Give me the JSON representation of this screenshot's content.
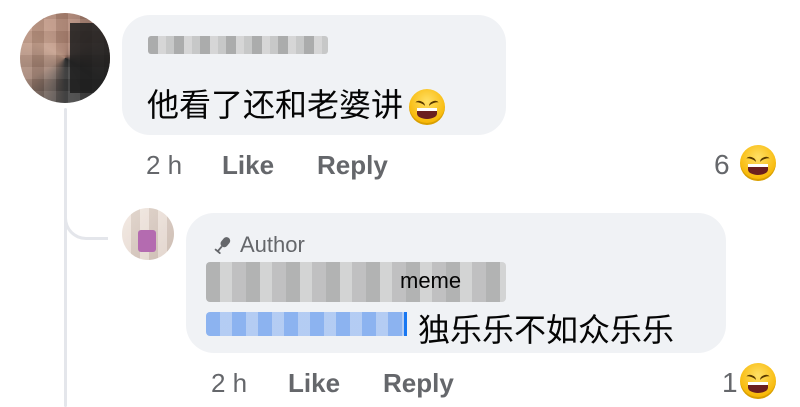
{
  "comment": {
    "text": "他看了还和老婆讲",
    "inline_emoji": "grinning-squinting-face",
    "time": "2 h",
    "like_label": "Like",
    "reply_label": "Reply",
    "reaction_count": "6",
    "reaction_emoji": "grinning-squinting-face"
  },
  "reply": {
    "badge_label": "Author",
    "badge_icon": "microphone-icon",
    "quote_fragment": "meme",
    "text": "独乐乐不如众乐乐",
    "time": "2 h",
    "like_label": "Like",
    "reply_label": "Reply",
    "reaction_count": "1",
    "reaction_emoji": "grinning-squinting-face"
  },
  "colors": {
    "bubble": "#f0f2f5",
    "meta": "#65676b",
    "text": "#050505",
    "link": "#1877f2"
  }
}
